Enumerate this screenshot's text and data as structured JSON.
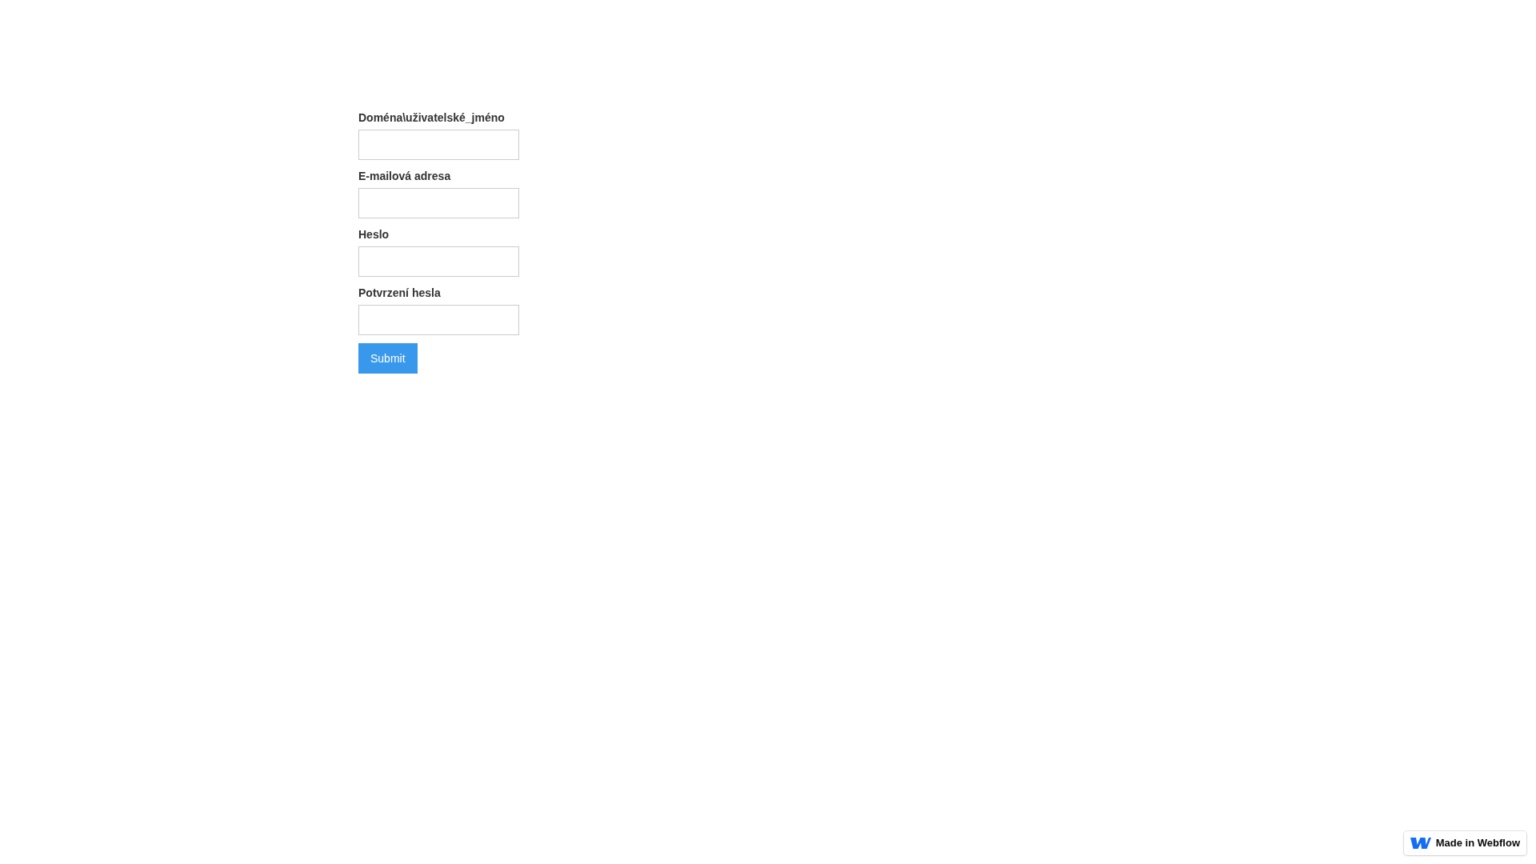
{
  "form": {
    "fields": [
      {
        "label": "Doména\\uživatelské_jméno"
      },
      {
        "label": "E-mailová adresa"
      },
      {
        "label": "Heslo"
      },
      {
        "label": "Potvrzení hesla"
      }
    ],
    "submit_button": {
      "label": "Submit"
    }
  },
  "badge": {
    "label": "Made in Webflow"
  }
}
